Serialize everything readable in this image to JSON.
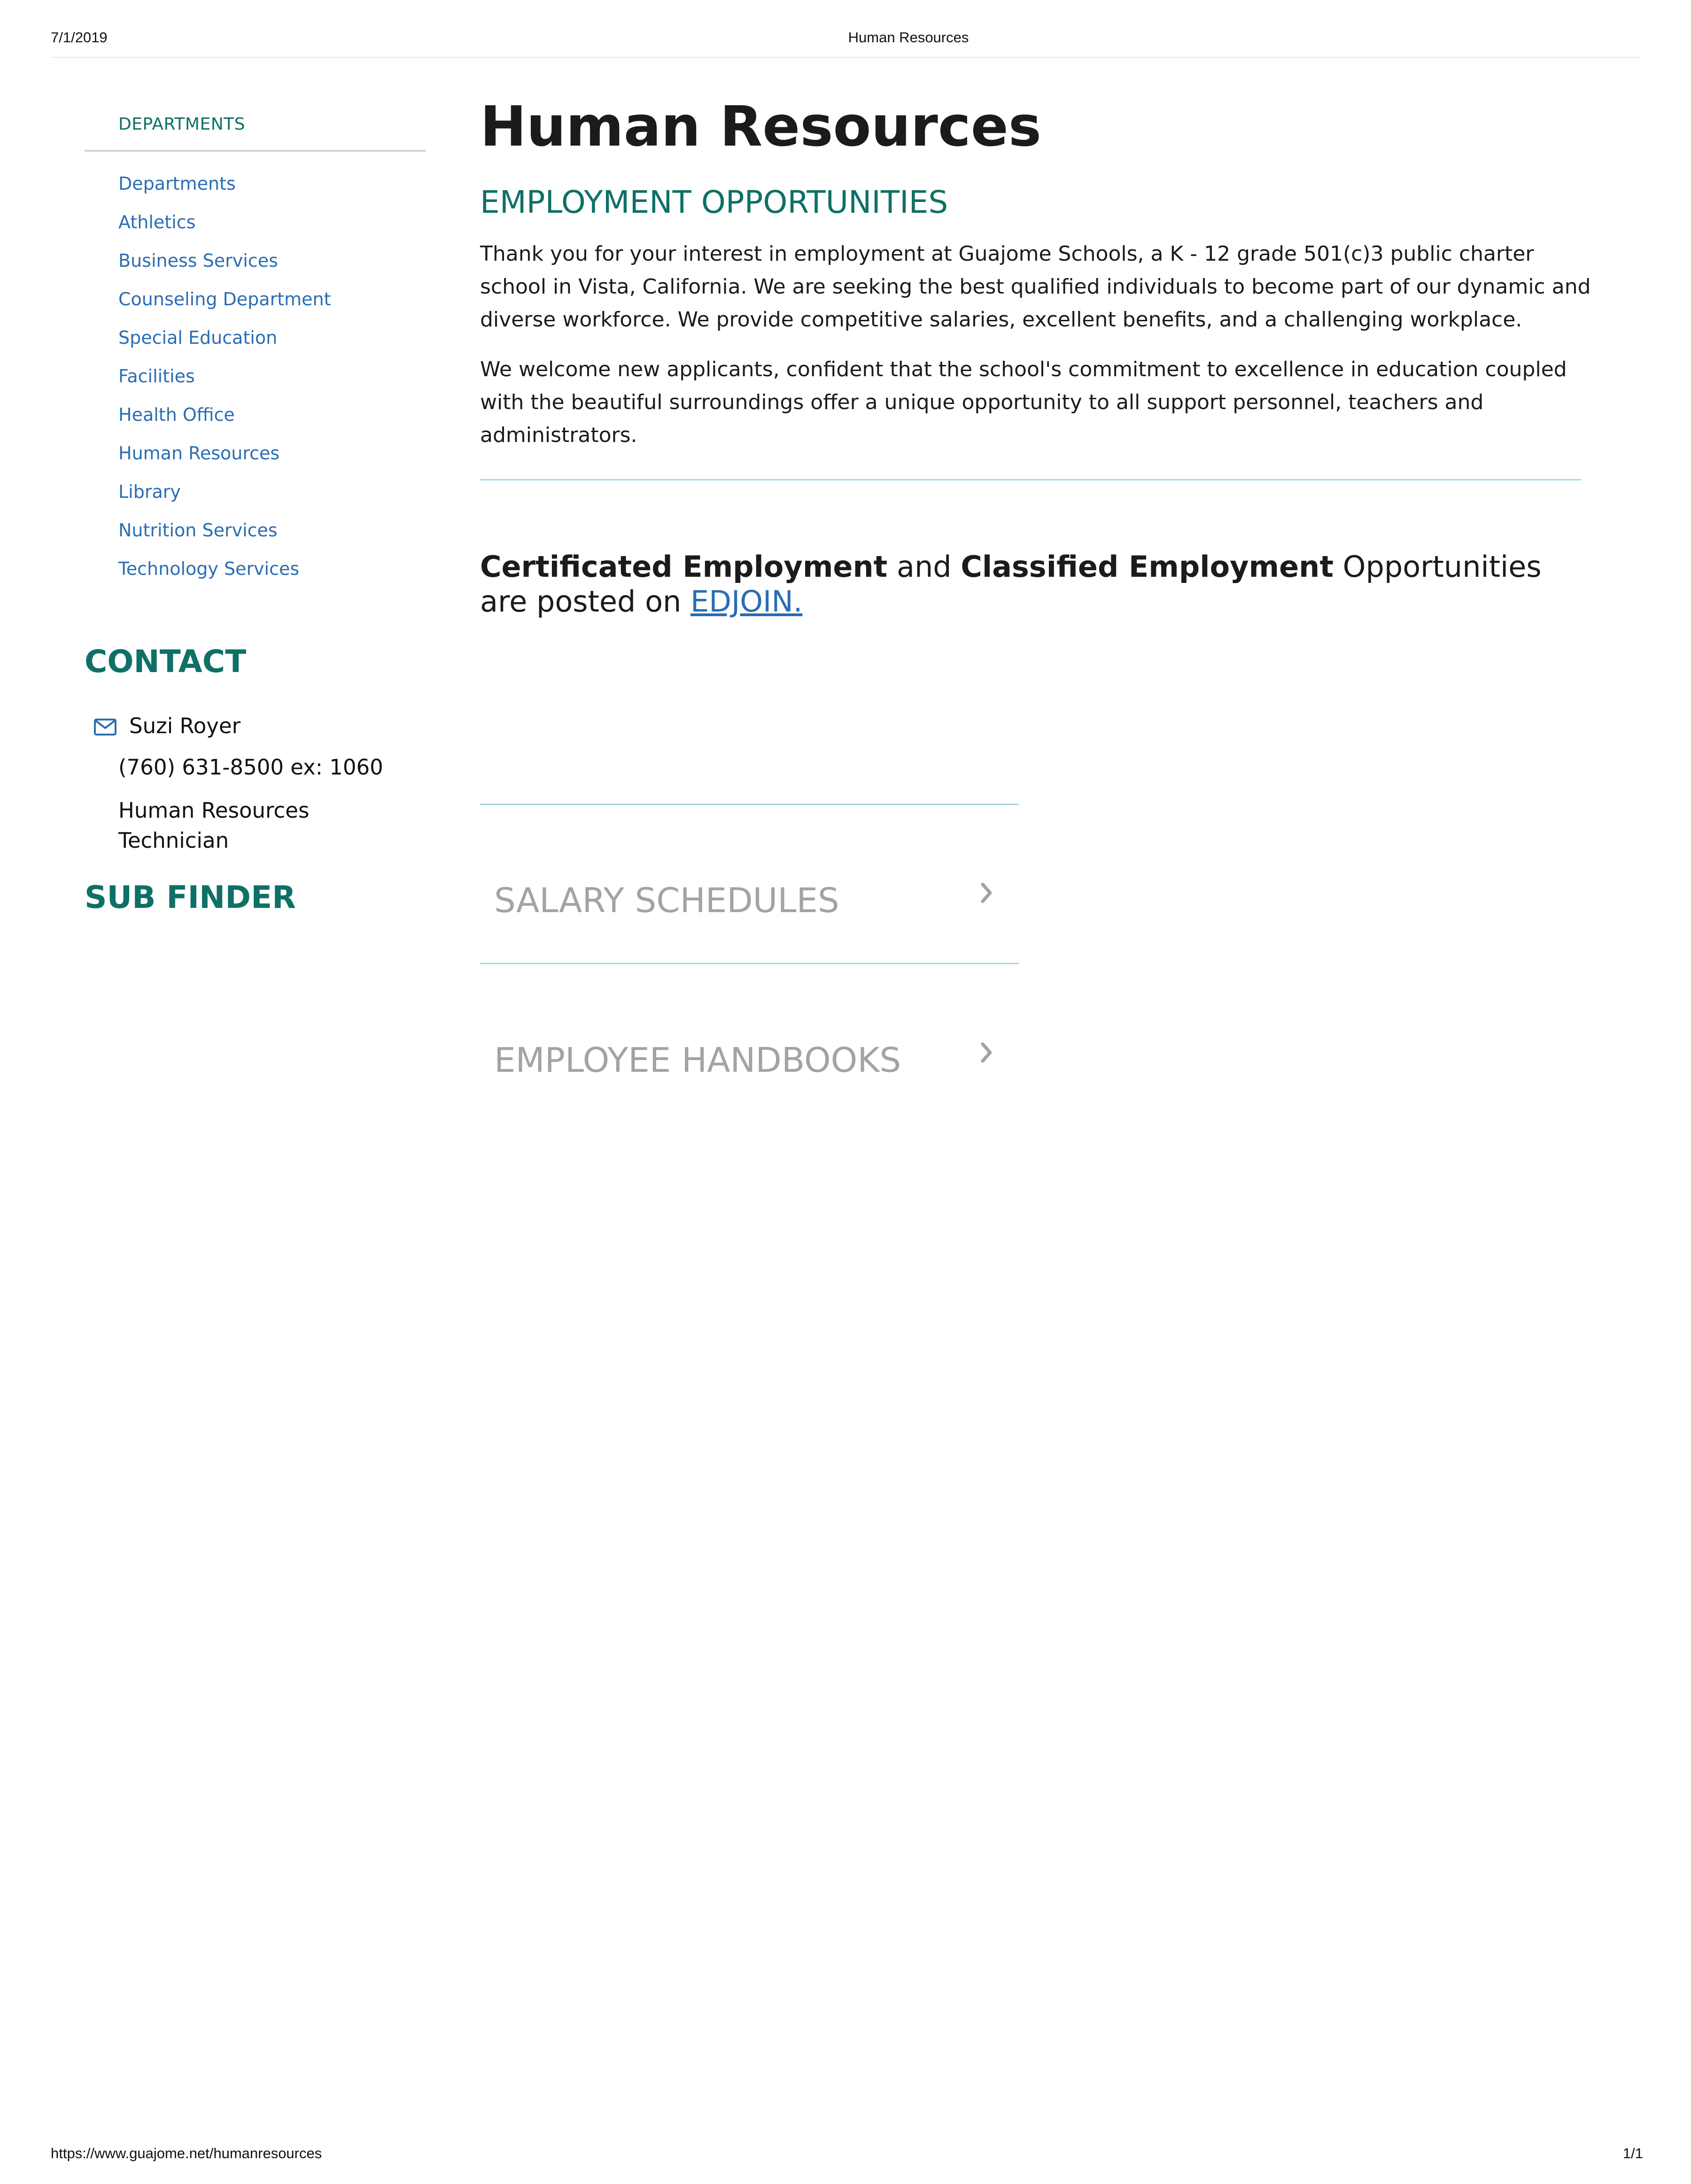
{
  "print": {
    "date": "7/1/2019",
    "title": "Human Resources",
    "url": "https://www.guajome.net/humanresources",
    "page": "1/1"
  },
  "sidebar": {
    "heading": "DEPARTMENTS",
    "items": [
      {
        "label": "Departments"
      },
      {
        "label": "Athletics"
      },
      {
        "label": "Business Services"
      },
      {
        "label": "Counseling Department"
      },
      {
        "label": "Special Education"
      },
      {
        "label": "Facilities"
      },
      {
        "label": "Health Office"
      },
      {
        "label": "Human Resources"
      },
      {
        "label": "Library"
      },
      {
        "label": "Nutrition Services"
      },
      {
        "label": "Technology Services"
      }
    ]
  },
  "contact": {
    "title": "CONTACT",
    "name": "Suzi Royer",
    "phone": "(760) 631-8500 ex: 1060",
    "role": "Human Resources Technician",
    "icon": "envelope-icon"
  },
  "subfinder": {
    "title": "SUB FINDER"
  },
  "main": {
    "title": "Human Resources",
    "section_title": "EMPLOYMENT OPPORTUNITIES",
    "paragraph1": "Thank you for your interest in employment at Guajome Schools, a K - 12 grade 501(c)3 public charter school in Vista, California. We are seeking the best qualified individuals to become part of our dynamic and diverse workforce. We provide competitive salaries, excellent benefits, and a challenging workplace.",
    "paragraph2": "We welcome new applicants, confident that the school's commitment to excellence in education coupled with the beautiful surroundings offer a unique opportunity to all support personnel, teachers and administrators.",
    "employment": {
      "certificated": "Certificated Employment",
      "and": " and ",
      "classified": "Classified Employment",
      "rest": " Opportunities are posted on ",
      "link": "EDJOIN."
    },
    "accordion": [
      {
        "label": "SALARY SCHEDULES",
        "icon": "chevron-right-icon"
      },
      {
        "label": "EMPLOYEE HANDBOOKS",
        "icon": "chevron-right-icon"
      }
    ]
  },
  "colors": {
    "teal": "#0e7066",
    "link_blue": "#2a6db3",
    "accordion_gray": "#a3a3a3",
    "rule_blue": "#a7d6e2"
  }
}
